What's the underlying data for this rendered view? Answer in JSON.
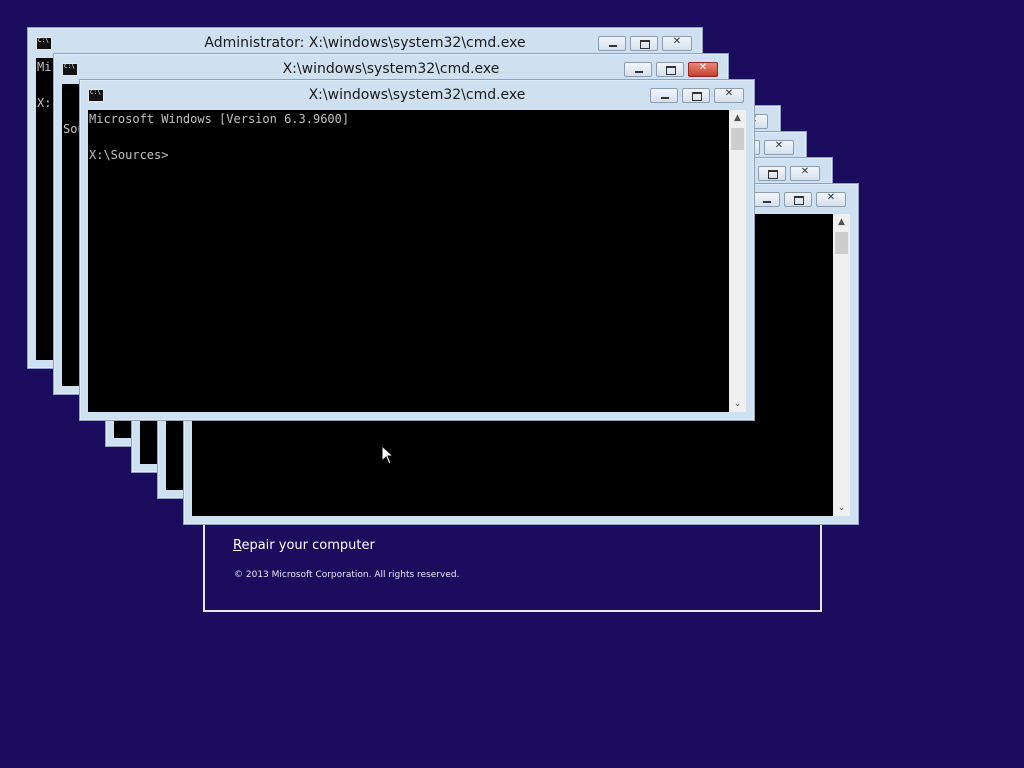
{
  "setup": {
    "repair_first": "R",
    "repair_rest": "epair your computer",
    "copyright": "© 2013 Microsoft Corporation. All rights reserved."
  },
  "windows": {
    "win1": {
      "title": "Administrator: X:\\windows\\system32\\cmd.exe",
      "text": "Mi\n\nX:"
    },
    "win2": {
      "title": "X:\\windows\\system32\\cmd.exe",
      "text": "\n\nSou"
    },
    "win3": {
      "title": "X:\\windows\\system32\\cmd.exe",
      "text": "Microsoft Windows [Version 6.3.9600]\n\nX:\\Sources>"
    },
    "stacked": {
      "title": "",
      "text": ""
    }
  },
  "icons": {
    "minimize": "minimize-icon",
    "maximize": "maximize-icon",
    "close": "close-icon",
    "app": "cmd-app-icon",
    "cursor": "mouse-pointer-icon"
  },
  "colors": {
    "desktop": "#1c0c5e",
    "frame": "#cfe0f0",
    "console_bg": "#000000",
    "console_text": "#c0c0c0",
    "close_active": "#c7402f"
  }
}
